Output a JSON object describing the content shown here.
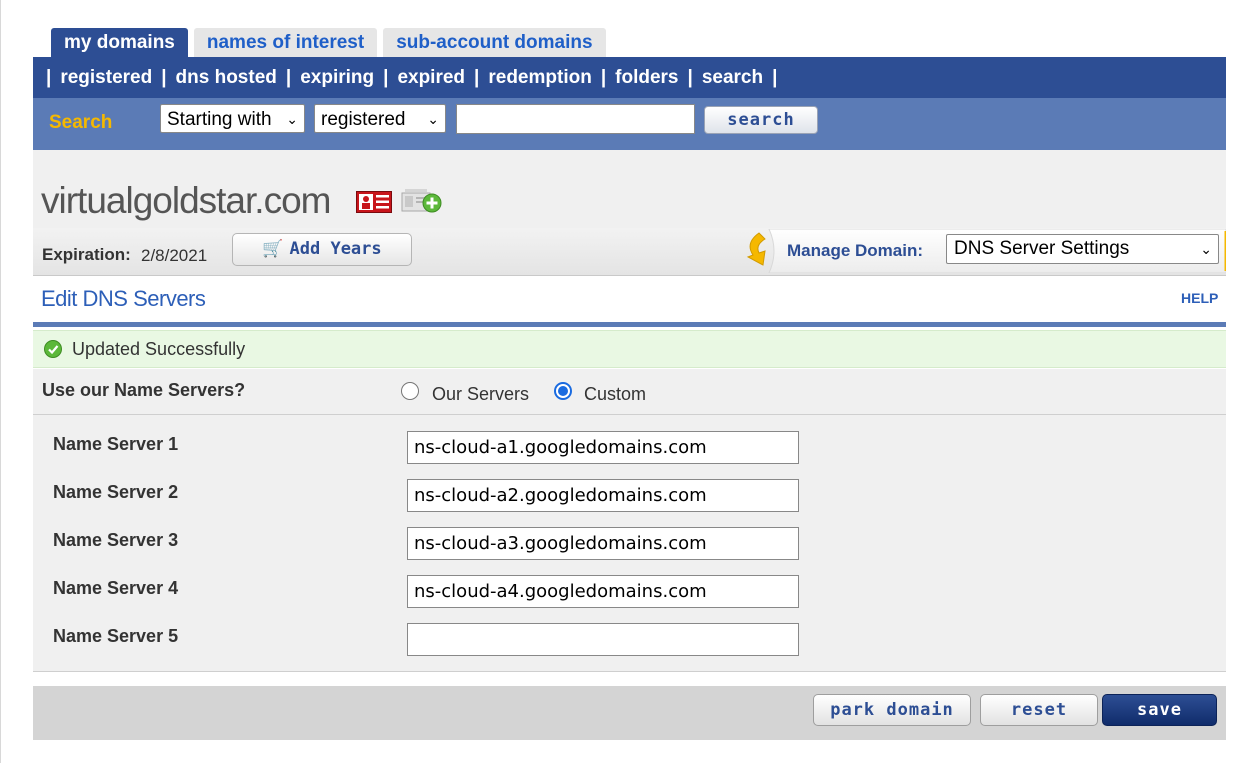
{
  "tabs": [
    {
      "label": "my domains",
      "active": true
    },
    {
      "label": "names of interest",
      "active": false
    },
    {
      "label": "sub-account domains",
      "active": false
    }
  ],
  "nav": {
    "items": [
      "registered",
      "dns hosted",
      "expiring",
      "expired",
      "redemption",
      "folders",
      "search"
    ]
  },
  "search": {
    "label": "Search",
    "mode_selected": "Starting with",
    "scope_selected": "registered",
    "query": "",
    "button": "search"
  },
  "domain": {
    "name": "virtualgoldstar.com",
    "expiration_label": "Expiration:",
    "expiration_value": "2/8/2021",
    "add_years": "Add Years",
    "manage_label": "Manage Domain:",
    "manage_selected": "DNS Server Settings"
  },
  "edit": {
    "title": "Edit DNS Servers",
    "help": "HELP",
    "success": "Updated Successfully",
    "use_label": "Use our Name Servers?",
    "option_our": "Our Servers",
    "option_custom": "Custom",
    "selected_option": "Custom"
  },
  "name_servers": [
    {
      "label": "Name Server 1",
      "value": "ns-cloud-a1.googledomains.com"
    },
    {
      "label": "Name Server 2",
      "value": "ns-cloud-a2.googledomains.com"
    },
    {
      "label": "Name Server 3",
      "value": "ns-cloud-a3.googledomains.com"
    },
    {
      "label": "Name Server 4",
      "value": "ns-cloud-a4.googledomains.com"
    },
    {
      "label": "Name Server 5",
      "value": ""
    }
  ],
  "footer": {
    "park": "park domain",
    "reset": "reset",
    "save": "save"
  },
  "colors": {
    "nav_blue": "#2d4e94",
    "search_bar": "#5b7bb6",
    "search_label": "#f5b800",
    "link_blue": "#2d5fb8",
    "success_bg": "#e9f8e3"
  }
}
